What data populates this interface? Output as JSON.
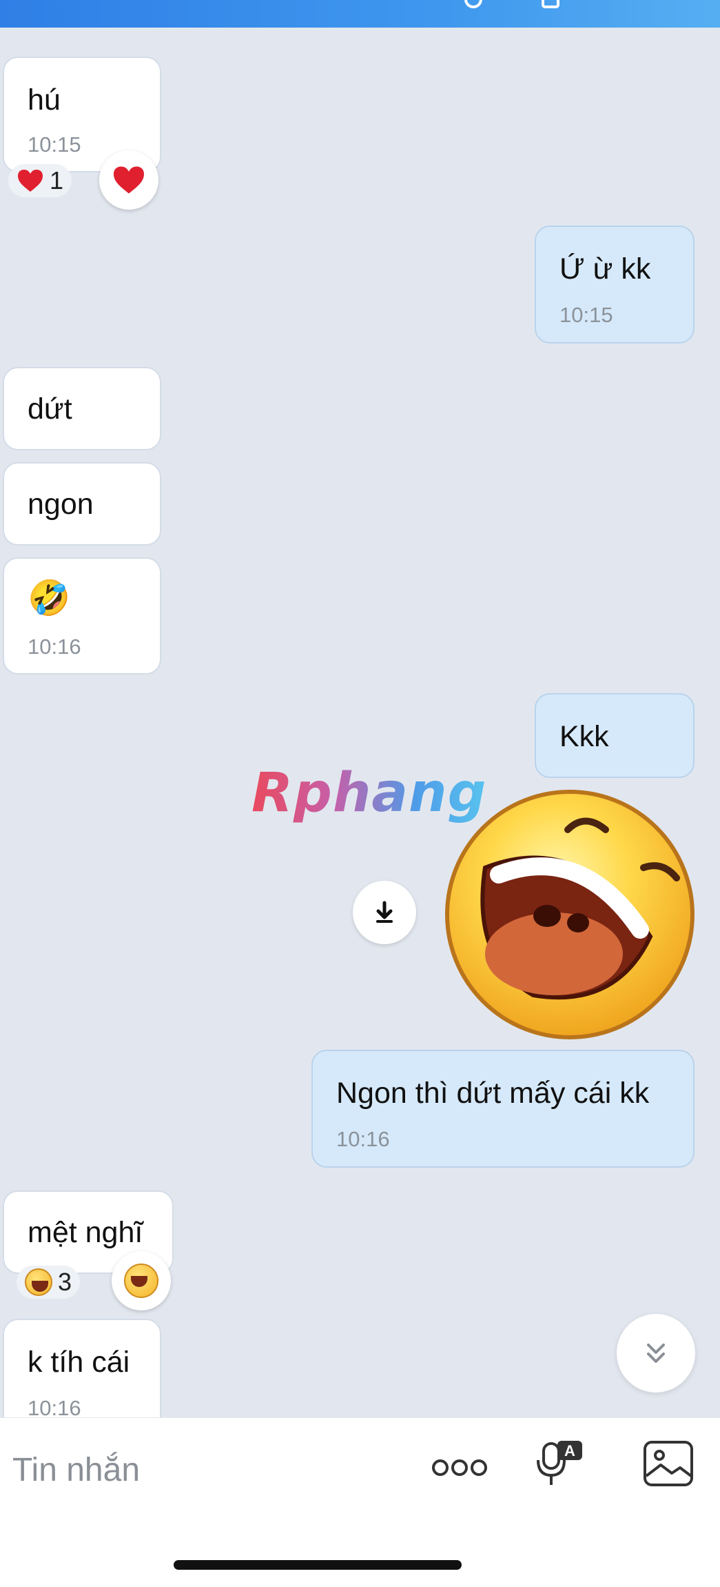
{
  "conversation": {
    "messages": [
      {
        "id": "m1",
        "side": "in",
        "text": "hú",
        "time": "10:15",
        "reaction": {
          "emoji": "heart-icon",
          "count": "1"
        }
      },
      {
        "id": "m2",
        "side": "out",
        "text": "Ứ ừ kk",
        "time": "10:15"
      },
      {
        "id": "m3",
        "side": "in",
        "text": "dứt"
      },
      {
        "id": "m4",
        "side": "in",
        "text": "ngon"
      },
      {
        "id": "m5",
        "side": "in",
        "text": "🤣",
        "time": "10:16"
      },
      {
        "id": "m6",
        "side": "out",
        "text": "Kkk"
      },
      {
        "id": "m7",
        "side": "out",
        "sticker": "laughing-face-sticker"
      },
      {
        "id": "m8",
        "side": "out",
        "text": "Ngon thì dứt mấy cái kk",
        "time": "10:16"
      },
      {
        "id": "m9",
        "side": "in",
        "text": "mệt nghĩ",
        "reaction": {
          "emoji": "laughing-face-icon",
          "count": "3"
        }
      },
      {
        "id": "m10",
        "side": "in",
        "text": "k tíh cái",
        "time": "10:16"
      }
    ]
  },
  "watermark": {
    "text": "Rphang"
  },
  "composer": {
    "placeholder": "Tin nhắn",
    "icons": [
      "more-options-icon",
      "voice-to-text-icon",
      "gallery-icon"
    ]
  },
  "colors": {
    "header": "#3f97ee",
    "background": "#e2e7ef",
    "incoming_bubble": "#ffffff",
    "outgoing_bubble": "#d6e9fa",
    "timestamp": "#8b929a"
  }
}
